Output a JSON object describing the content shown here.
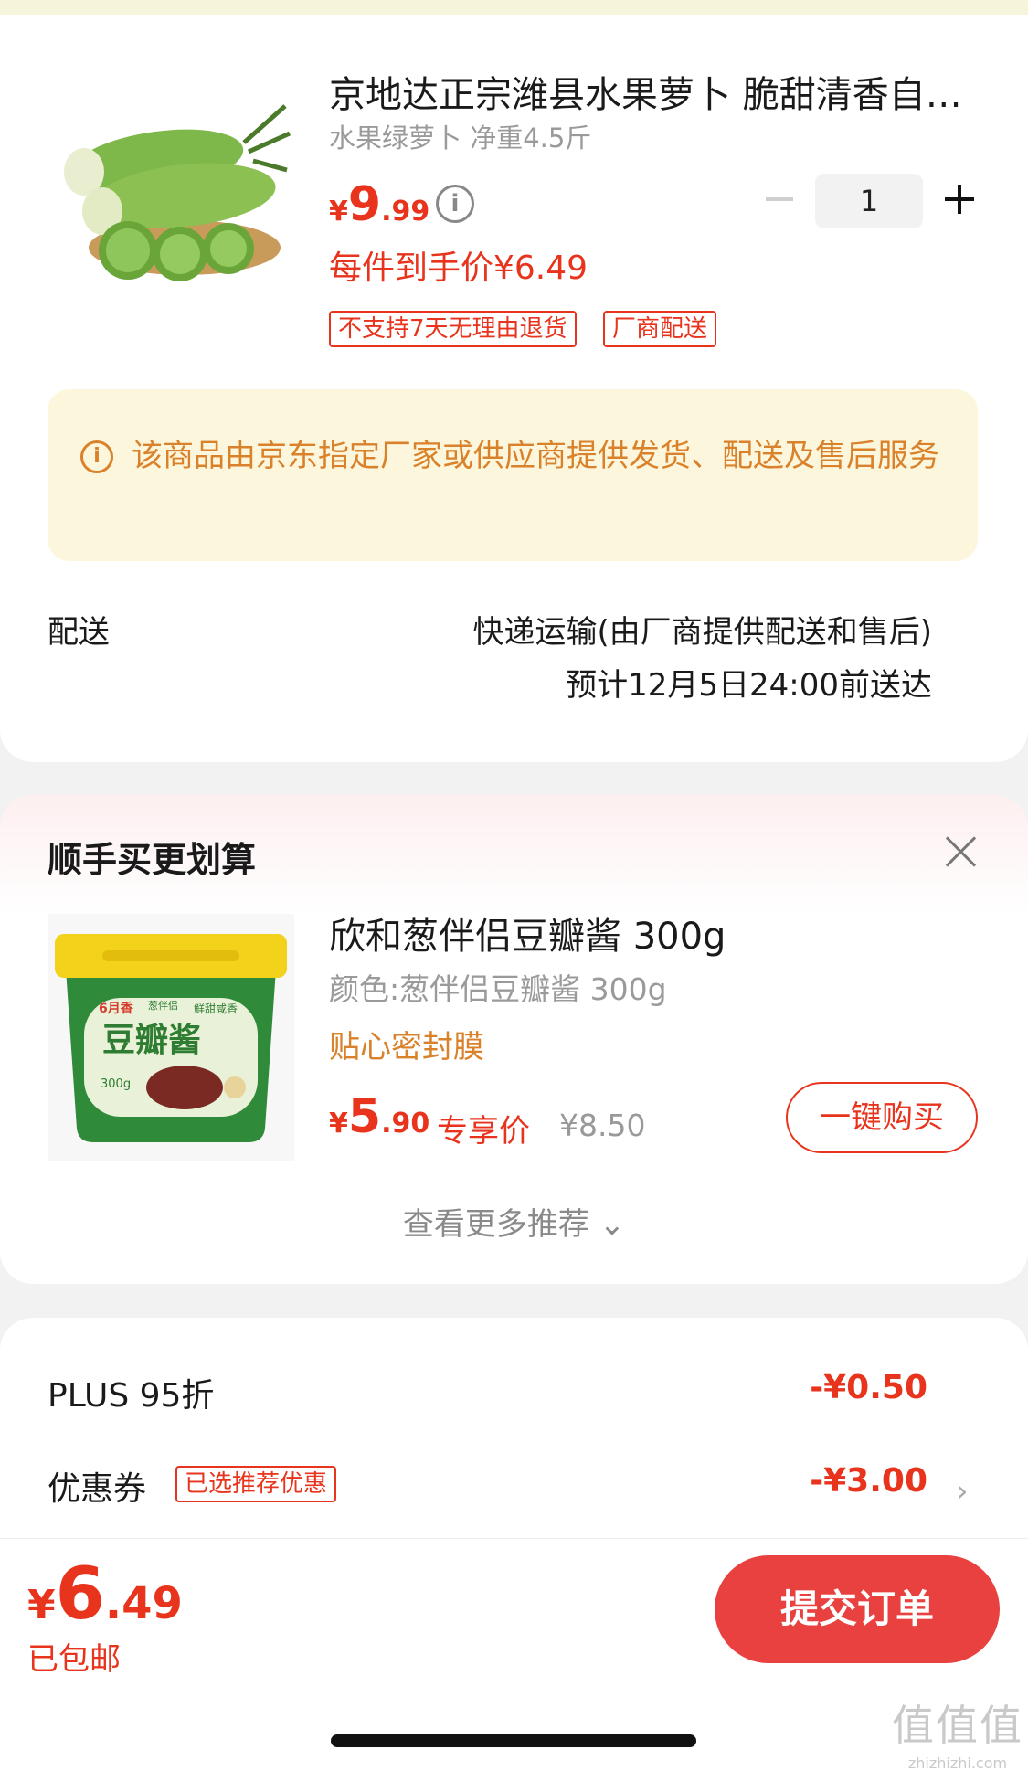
{
  "product": {
    "title": "京地达正宗潍县水果萝卜 脆甜清香自…",
    "spec": "水果绿萝卜 净重4.5斤",
    "price": {
      "currency": "¥",
      "integer": "9",
      "decimal": ".99"
    },
    "deal_price": "每件到手价¥6.49",
    "tags": [
      "不支持7天无理由退货",
      "厂商配送"
    ],
    "quantity": "1"
  },
  "notice": {
    "icon": "i",
    "text": "该商品由京东指定厂家或供应商提供发货、配送及售后服务"
  },
  "shipping": {
    "label": "配送",
    "method": "快递运输(由厂商提供配送和售后)",
    "eta": "预计12月5日24:00前送达"
  },
  "recommend": {
    "title": "顺手买更划算",
    "product_title": "欣和葱伴侣豆瓣酱 300g",
    "product_spec": "颜色:葱伴侣豆瓣酱 300g",
    "feature": "贴心密封膜",
    "price": {
      "currency": "¥",
      "integer": "5",
      "decimal": ".90"
    },
    "exclusive_label": "专享价",
    "original_price": "¥8.50",
    "buy_label": "一键购买",
    "more_label": "查看更多推荐 ⌄",
    "package": {
      "badge": "6月香",
      "brand": "葱伴侣",
      "tagline": "鲜甜咸香",
      "name": "豆瓣酱",
      "weight": "300g"
    }
  },
  "discounts": {
    "plus_label": "PLUS 95折",
    "plus_value": "-¥0.50",
    "coupon_label": "优惠券",
    "coupon_tag": "已选推荐优惠",
    "coupon_value": "-¥3.00",
    "chevron": "›"
  },
  "bottom": {
    "price": {
      "currency": "¥",
      "integer": "6",
      "decimal": ".49"
    },
    "free_shipping": "已包邮",
    "submit_label": "提交订单",
    "watermark_logo": "值值值",
    "watermark_url": "zhizhizhi.com"
  },
  "colors": {
    "accent": "#e8331d",
    "submit": "#e8413f",
    "notice_bg": "#fcf7dc",
    "notice_text": "#d9822b"
  }
}
